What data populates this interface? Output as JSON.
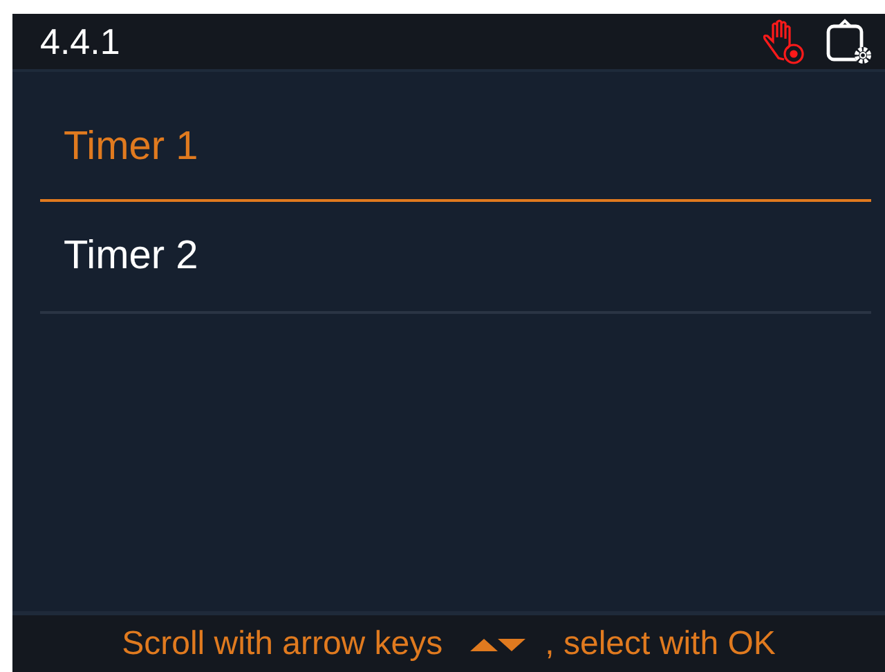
{
  "header": {
    "title": "4.4.1"
  },
  "items": [
    {
      "label": "Timer 1",
      "selected": true
    },
    {
      "label": "Timer 2",
      "selected": false
    }
  ],
  "footer": {
    "hint_before": "Scroll with arrow keys",
    "hint_after": ", select with OK"
  }
}
